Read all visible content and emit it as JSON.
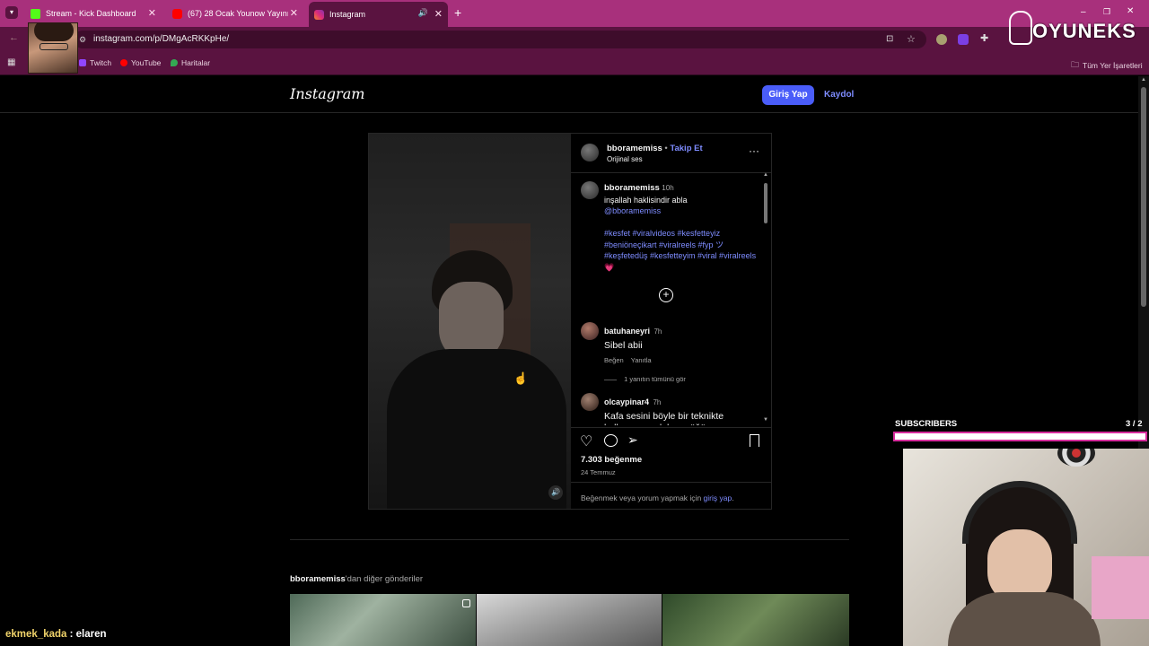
{
  "browser": {
    "tabs": [
      {
        "title": "Stream - Kick Dashboard",
        "color": "#53fc18"
      },
      {
        "title": "(67) 28 Ocak Younow Yayını - S",
        "color": "#ff0000"
      },
      {
        "title": "Instagram",
        "color": "#e1306c"
      }
    ],
    "url": "instagram.com/p/DMgAcRKKpHe/",
    "bookmarks": [
      "Twitch",
      "YouTube",
      "Haritalar"
    ],
    "all_bookmarks": "Tüm Yer İşaretleri"
  },
  "instagram": {
    "logo": "Instagram",
    "login_label": "Giriş Yap",
    "signup_label": "Kaydol",
    "post": {
      "author": "bboramemiss",
      "follow_label": "Takip Et",
      "audio": "Orijinal ses",
      "caption_author": "bboramemiss",
      "caption_time": "10h",
      "caption_text": "inşallah haklisindir abla",
      "caption_mention": "@bboramemiss",
      "hashtags": "#kesfet #viralvideos #kesfetteyiz #beniöneçikart #viralreels #fyp ツ #keşfetedüş #kesfetteyim #viral #viralreels",
      "heart_emoji": "💗",
      "comments": [
        {
          "user": "batuhaneyri",
          "time": "7h",
          "text": "Sibel abii",
          "like": "Beğen",
          "reply": "Yanıtla",
          "view_replies": "1 yanıtın tümünü gör"
        },
        {
          "user": "olcaypinar4",
          "time": "7h",
          "text": "Kafa sesini böyle bir teknikte kullanman çok hoş göğüs"
        }
      ],
      "likes": "7.303 beğenme",
      "date": "24 Temmuz",
      "login_prompt": "Beğenmek veya yorum yapmak için",
      "login_link": "giriş yap",
      "login_dot": "."
    },
    "more_posts_user": "bboramemiss",
    "more_posts_suffix": "'dan diğer gönderiler"
  },
  "overlay": {
    "brand": "OYUNEKS",
    "subscribers_label": "SUBSCRIBERS",
    "subscribers_count": "3 / 2",
    "chat_user": "ekmek_kada",
    "chat_sep": " : ",
    "chat_message": "elaren"
  }
}
